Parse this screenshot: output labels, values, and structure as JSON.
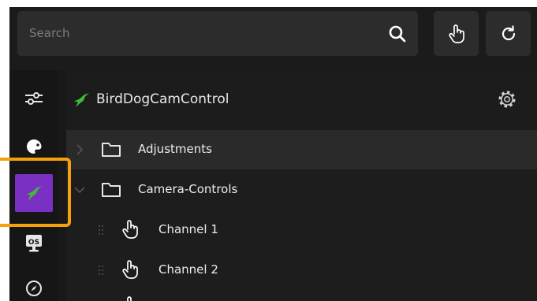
{
  "search": {
    "placeholder": "Search"
  },
  "sidebar": {
    "items": [
      {
        "icon": "sliders-icon"
      },
      {
        "icon": "palette-icon"
      },
      {
        "icon": "bird-icon",
        "active": true
      },
      {
        "icon": "os-monitor-icon"
      },
      {
        "icon": "compass-icon"
      }
    ]
  },
  "tree": {
    "title": "BirdDogCamControl",
    "items": [
      {
        "label": "Adjustments",
        "type": "folder",
        "expanded": false
      },
      {
        "label": "Camera-Controls",
        "type": "folder",
        "expanded": true
      },
      {
        "label": "Channel 1",
        "type": "action"
      },
      {
        "label": "Channel 2",
        "type": "action"
      }
    ]
  },
  "colors": {
    "accent": "#7b30c4",
    "highlight": "#f5a10b",
    "bird": "#3fbd3a"
  }
}
